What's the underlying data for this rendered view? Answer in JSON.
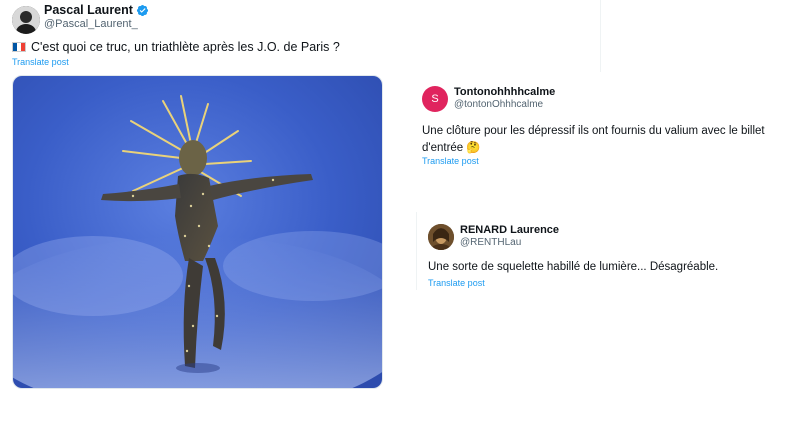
{
  "main_post": {
    "author_name": "Pascal Laurent",
    "author_handle": "@Pascal_Laurent_",
    "text": "C'est quoi ce truc, un triathlète après les J.O. de Paris ?",
    "translate_label": "Translate post",
    "flag_colors": [
      "#0055a4",
      "#ffffff",
      "#ef4135"
    ]
  },
  "replies": [
    {
      "avatar_letter": "S",
      "avatar_color": "#e0245e",
      "author_name": "Tontonohhhhcalme",
      "author_handle": "@tontonOhhhcalme",
      "text": "Une clôture pour les dépressif ils ont  fournis du valium avec le billet d'entrée 🤔",
      "translate_label": "Translate post"
    },
    {
      "author_name": "RENARD Laurence",
      "author_handle": "@RENTHLau",
      "text": "Une sorte de squelette habillé de lumière... Désagréable.",
      "translate_label": "Translate post"
    }
  ],
  "colors": {
    "link": "#1d9bf0",
    "verified": "#1d9bf0",
    "media_background": "#3f63c9"
  }
}
